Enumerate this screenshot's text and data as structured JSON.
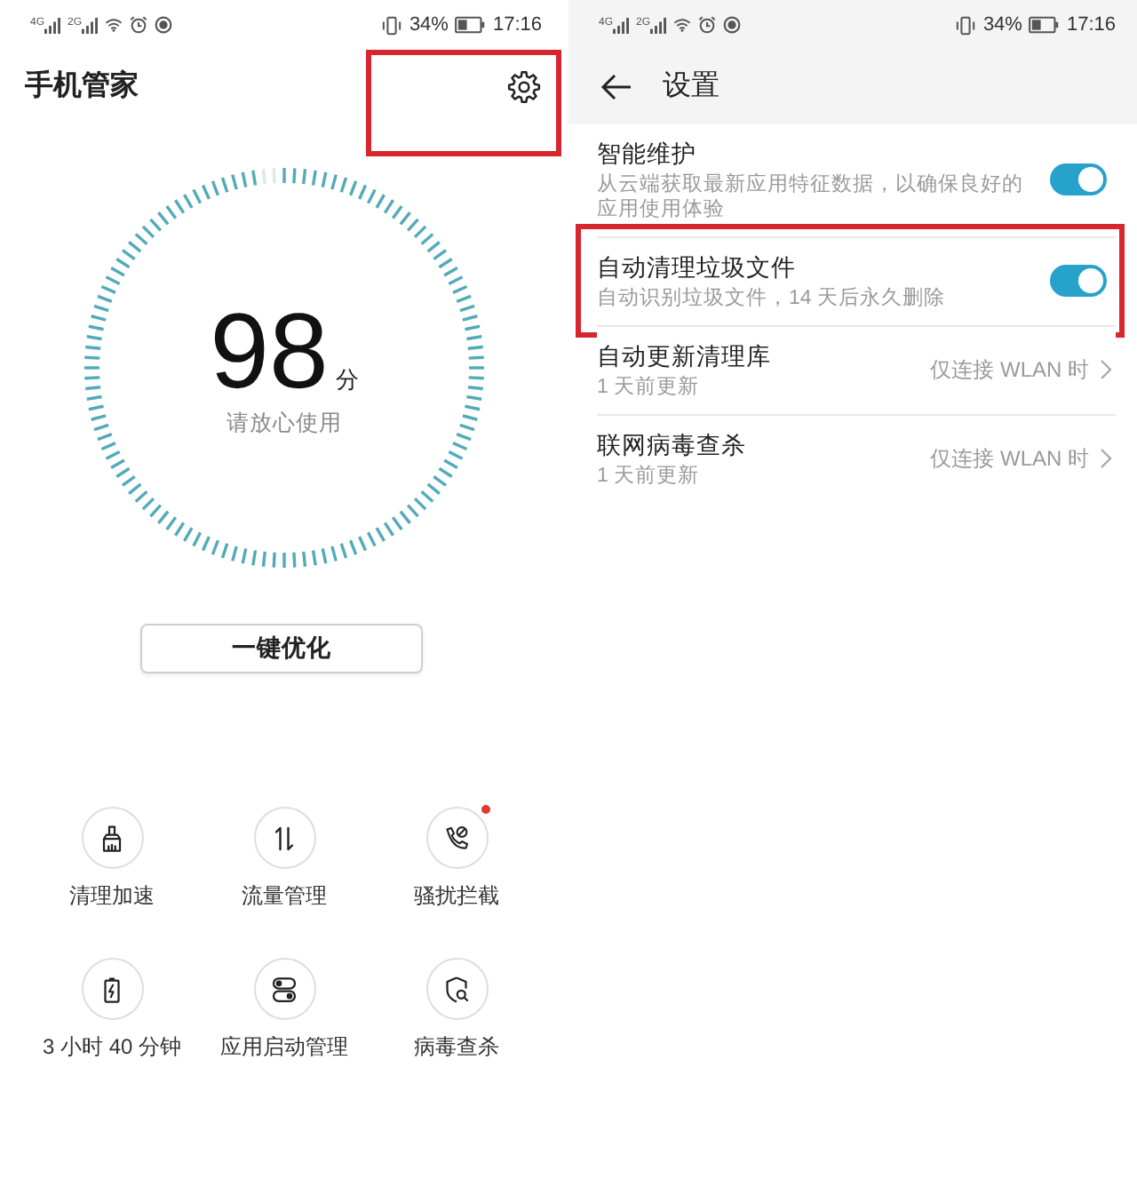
{
  "home_screen": {
    "status_bar": {
      "networks": [
        "4G",
        "2G"
      ],
      "battery": "34%",
      "time": "17:16"
    },
    "title": "手机管家",
    "settings_button": {
      "highlighted": true
    },
    "score": {
      "value": "98",
      "unit": "分",
      "caption": "请放心使用",
      "level": 0.98
    },
    "optimize_button": "一键优化",
    "tools": [
      {
        "label": "清理加速",
        "badge": false
      },
      {
        "label": "流量管理",
        "badge": false
      },
      {
        "label": "骚扰拦截",
        "badge": true
      },
      {
        "label": "3 小时 40 分钟",
        "badge": false
      },
      {
        "label": "应用启动管理",
        "badge": false
      },
      {
        "label": "病毒查杀",
        "badge": false
      }
    ]
  },
  "settings_screen": {
    "status_bar": {
      "networks": [
        "4G",
        "2G"
      ],
      "battery": "34%",
      "time": "17:16"
    },
    "title": "设置",
    "items": [
      {
        "kind": "toggle",
        "title": "智能维护",
        "description": "从云端获取最新应用特征数据，以确保良好的应用使用体验",
        "on": true,
        "highlighted": false
      },
      {
        "kind": "toggle",
        "title": "自动清理垃圾文件",
        "description": "自动识别垃圾文件，14 天后永久删除",
        "on": true,
        "highlighted": true
      },
      {
        "kind": "link",
        "title": "自动更新清理库",
        "description": "1 天前更新",
        "value": "仅连接 WLAN 时",
        "highlighted": false
      },
      {
        "kind": "link",
        "title": "联网病毒查杀",
        "description": "1 天前更新",
        "value": "仅连接 WLAN 时",
        "highlighted": false
      }
    ]
  }
}
